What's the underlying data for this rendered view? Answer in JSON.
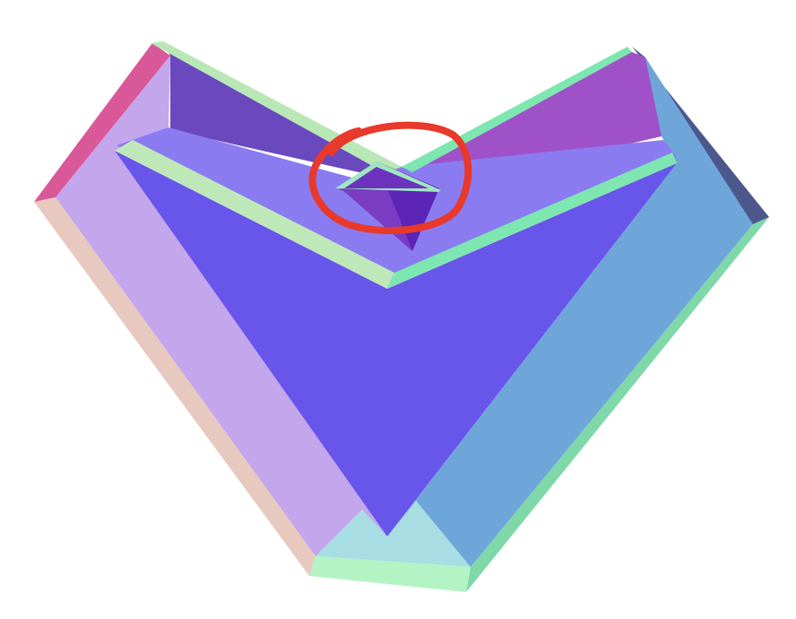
{
  "image": {
    "subject": "3d-rendered-faceted-heart-shape",
    "background_color": "#ffffff",
    "annotation": {
      "shape": "hand-drawn-ellipse",
      "color": "#e8392b"
    },
    "palette": {
      "left_outer_top": "#d9589a",
      "left_outer_side": "#e8c9bf",
      "left_slope_face": "#c3a6ec",
      "left_inner_wall": "#6a49bf",
      "left_inner_rim": "#b9e8b6",
      "right_outer_top": "#4c588c",
      "right_outer_side": "#7ed8a8",
      "right_slope_face": "#6fa6d9",
      "right_inner_wall": "#9f52c8",
      "right_inner_rim": "#7ee6b0",
      "center_face": "#6855ea",
      "inner_floor": "#8a7cf0",
      "notch_dark": "#5d24b8",
      "notch_mid": "#7a3cc2",
      "bottom_tip_top": "#a7dde3",
      "bottom_tip_front": "#b3f3c4"
    }
  }
}
